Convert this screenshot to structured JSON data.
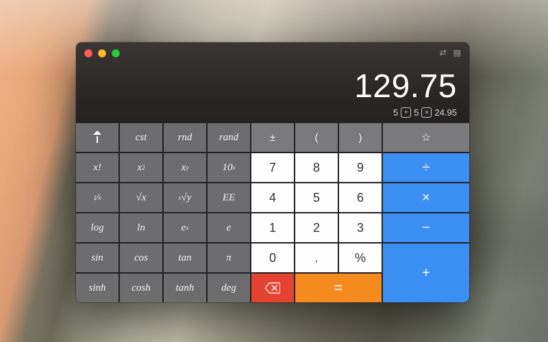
{
  "display": {
    "result": "129.75",
    "tape_a": "5",
    "tape_op1": "+",
    "tape_b": "5",
    "tape_op2": "×",
    "tape_c": "24.95"
  },
  "keys": {
    "cst": "cst",
    "rnd": "rnd",
    "rand": "rand",
    "pm": "±",
    "lp": "(",
    "rp": ")",
    "fact": "x!",
    "sq_base": "x",
    "sq_exp": "2",
    "pow_base": "x",
    "pow_exp": "y",
    "tenx_base": "10",
    "tenx_exp": "x",
    "recip_num": "1",
    "recip_den": "x",
    "sqrt": "√x",
    "nroot_exp": "x",
    "nroot_rad": "√y",
    "ee": "EE",
    "log": "log",
    "ln": "ln",
    "ex_base": "e",
    "ex_exp": "x",
    "e": "e",
    "sin": "sin",
    "cos": "cos",
    "tan": "tan",
    "pi": "π",
    "sinh": "sinh",
    "cosh": "cosh",
    "tanh": "tanh",
    "deg": "deg",
    "d7": "7",
    "d8": "8",
    "d9": "9",
    "d4": "4",
    "d5": "5",
    "d6": "6",
    "d1": "1",
    "d2": "2",
    "d3": "3",
    "d0": "0",
    "dot": ".",
    "pct": "%",
    "div": "÷",
    "mul": "×",
    "sub": "−",
    "add": "+",
    "eq": "=",
    "star": "☆"
  }
}
